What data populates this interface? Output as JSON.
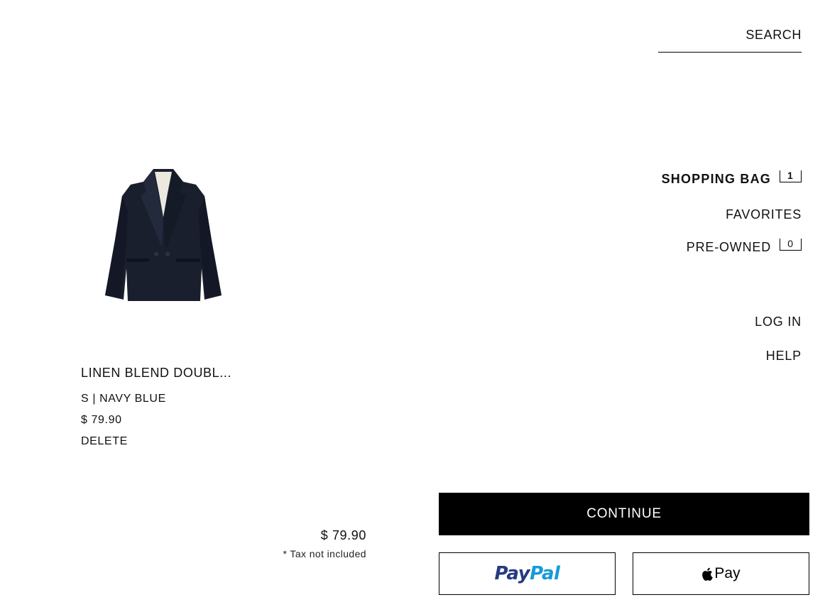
{
  "search": {
    "label": "SEARCH"
  },
  "nav": {
    "shopping_bag": {
      "label": "SHOPPING BAG",
      "count": "1"
    },
    "favorites": {
      "label": "FAVORITES"
    },
    "pre_owned": {
      "label": "PRE-OWNED",
      "count": "0"
    },
    "log_in": {
      "label": "LOG IN"
    },
    "help": {
      "label": "HELP"
    }
  },
  "cart": {
    "items": [
      {
        "title": "LINEN BLEND DOUBL...",
        "variant": "S | NAVY BLUE",
        "price": "$ 79.90",
        "delete_label": "DELETE",
        "image_icon": "navy-blazer-image"
      }
    ]
  },
  "summary": {
    "total": "$ 79.90",
    "tax_note": "* Tax not included"
  },
  "actions": {
    "continue_label": "CONTINUE",
    "paypal": {
      "pay": "Pay",
      "pal": "Pal"
    },
    "apple_pay": {
      "label": "Pay"
    }
  },
  "colors": {
    "accent": "#000000",
    "paypal_dark": "#253b80",
    "paypal_light": "#179bd7",
    "blazer": "#1a1f2e"
  }
}
